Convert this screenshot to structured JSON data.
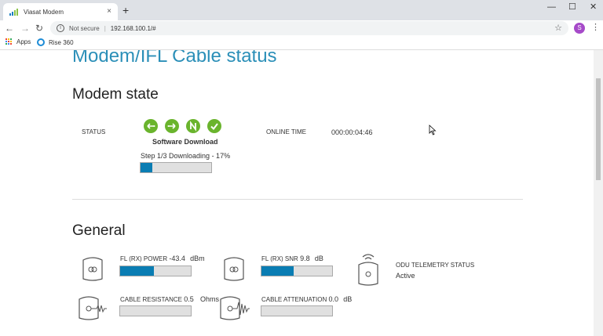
{
  "browser": {
    "tab_title": "Viasat Modem",
    "tab_close": "×",
    "new_tab": "+",
    "win_min": "—",
    "win_max": "☐",
    "win_close": "✕",
    "back": "←",
    "forward": "→",
    "reload": "↻",
    "not_secure": "Not secure",
    "separator": "|",
    "url": "192.168.100.1/#",
    "star": "☆",
    "profile_initial": "S",
    "menu": "⋮",
    "bookmarks": [
      "Apps",
      "Rise 360"
    ]
  },
  "page": {
    "title": "Modem/IFL Cable status",
    "modem_state": {
      "heading": "Modem state",
      "status_label": "STATUS",
      "status_text": "Software Download",
      "step_text": "Step 1/3 Downloading - 17%",
      "progress_fraction": 0.17,
      "online_time_label": "ONLINE TIME",
      "online_time_value": "000:00:04:46"
    },
    "general": {
      "heading": "General",
      "fl_rx_power": {
        "label": "FL (RX) POWER",
        "value": "-43.4",
        "unit": "dBm",
        "fraction": 0.48
      },
      "fl_rx_snr": {
        "label": "FL (RX) SNR",
        "value": "9.8",
        "unit": "dB",
        "fraction": 0.45
      },
      "odu_telemetry": {
        "label": "ODU TELEMETRY STATUS",
        "value": "Active"
      },
      "cable_resistance": {
        "label": "CABLE RESISTANCE",
        "value": "0.5",
        "unit": "Ohms",
        "fraction": 0
      },
      "cable_attenuation": {
        "label": "CABLE ATTENUATION",
        "value": "0.0",
        "unit": "dB",
        "fraction": 0
      }
    }
  },
  "colors": {
    "accent": "#0a7db3",
    "title": "#2b8fb8",
    "status_green": "#6ab42d"
  }
}
